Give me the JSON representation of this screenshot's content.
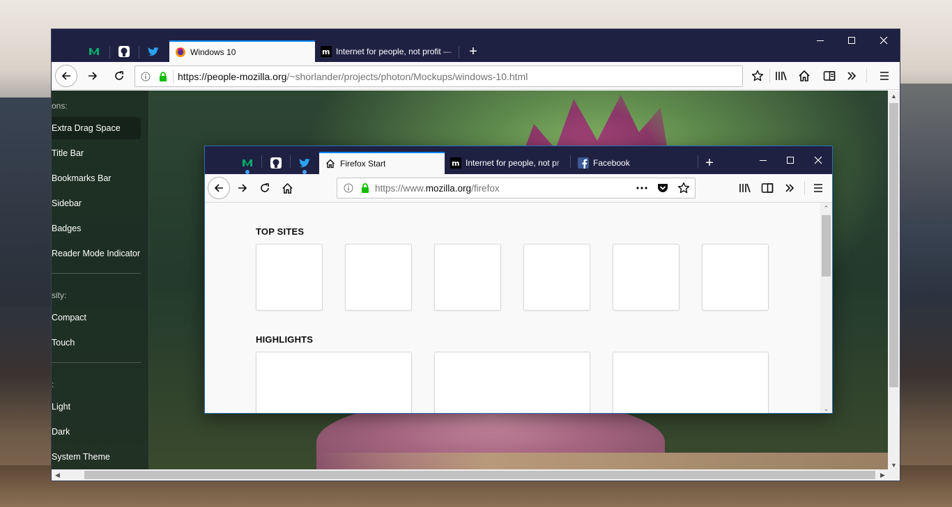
{
  "outer": {
    "tabs": [
      {
        "title": "Windows 10",
        "selected": true
      },
      {
        "title": "Internet for people, not profit —",
        "selected": false
      }
    ],
    "pinned": [
      "medium-icon",
      "github-icon",
      "twitter-icon"
    ],
    "url": {
      "host": "https://people-mozilla.org",
      "path": "/~shorlander/projects/photon/Mockups/windows-10.html"
    }
  },
  "sidebar": {
    "heading1": "ons:",
    "options": [
      "Extra Drag Space",
      "Title Bar",
      "Bookmarks Bar",
      "Sidebar",
      "Badges",
      "Reader Mode Indicator"
    ],
    "heading2": "sity:",
    "density": [
      "Compact",
      "Touch"
    ],
    "heading3": ":",
    "theme": [
      "Light",
      "Dark",
      "System Theme"
    ]
  },
  "inner": {
    "tabs": [
      {
        "title": "Firefox Start",
        "selected": true
      },
      {
        "title": "Internet for people, not pr",
        "selected": false
      },
      {
        "title": "Facebook",
        "selected": false
      }
    ],
    "url": {
      "scheme": "https://www.",
      "host": "mozilla.org",
      "path": "/firefox"
    },
    "top_sites_title": "TOP SITES",
    "highlights_title": "HIGHLIGHTS"
  },
  "colors": {
    "titlebar": "#1f2142",
    "accent": "#0a84ff",
    "secure": "#12bc00"
  }
}
